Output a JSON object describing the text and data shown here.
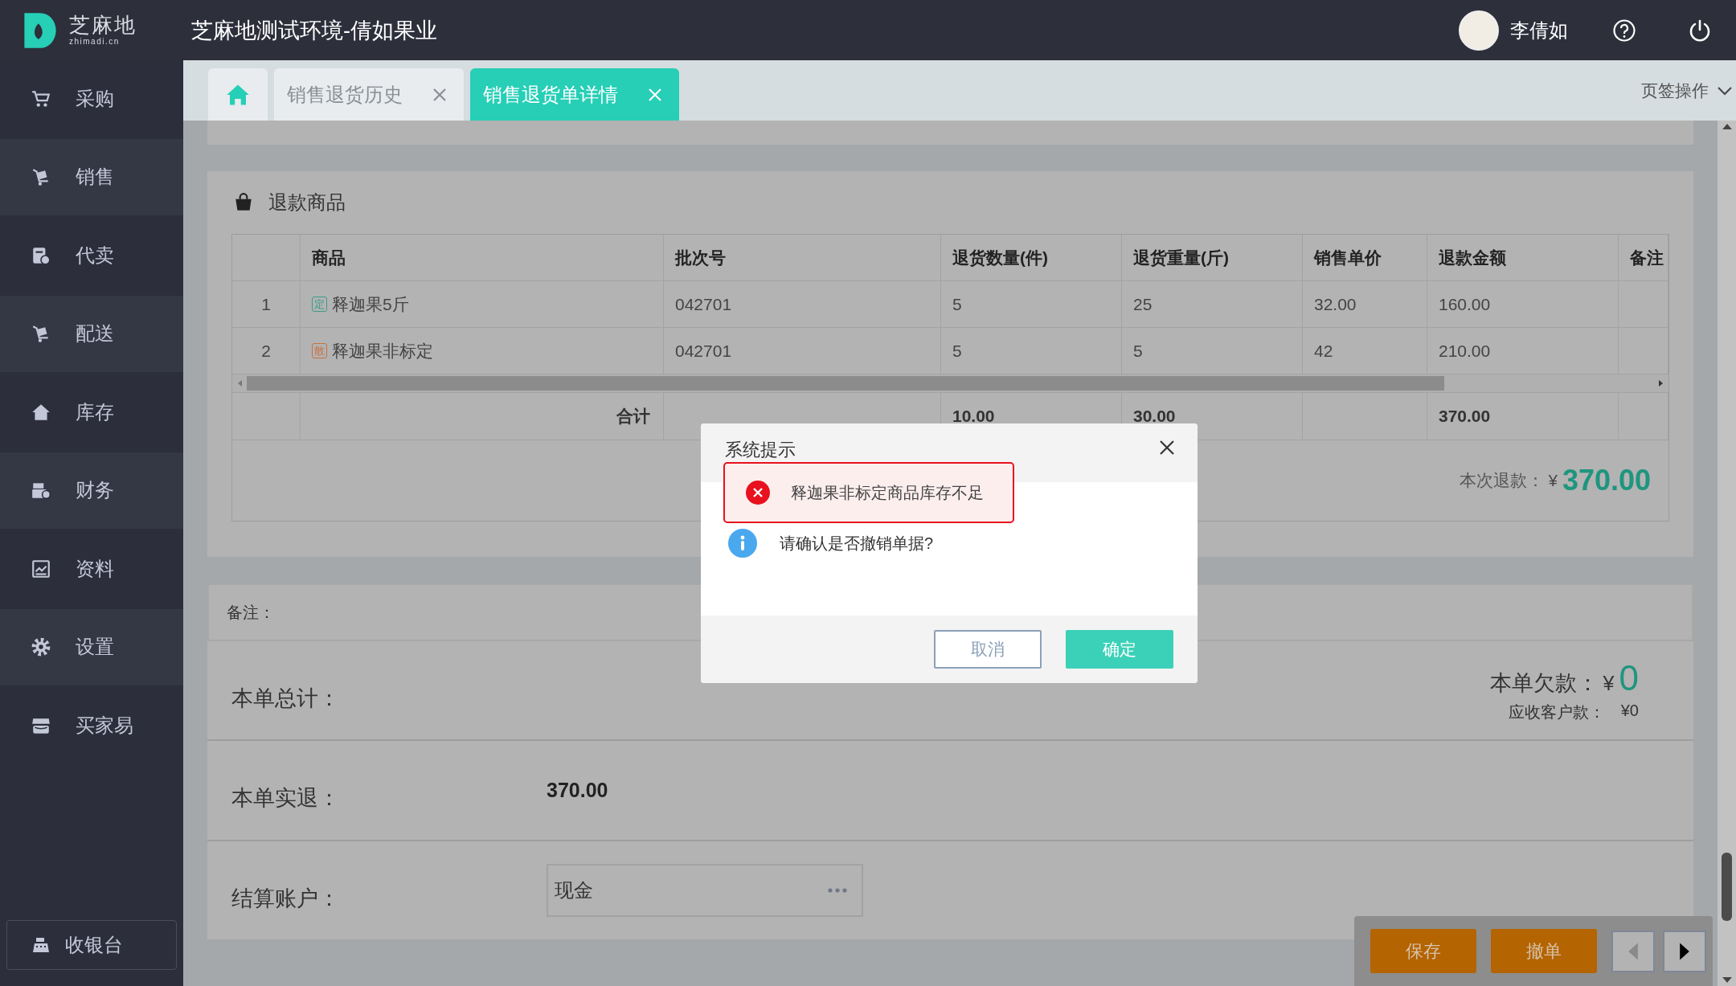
{
  "app": {
    "logo_text": "芝麻地",
    "logo_subtext": "zhimadi.cn",
    "title": "芝麻地测试环境-倩如果业"
  },
  "user": {
    "name": "李倩如"
  },
  "sidebar": {
    "items": [
      {
        "label": "采购",
        "kind": "cart"
      },
      {
        "label": "销售",
        "kind": "trolley"
      },
      {
        "label": "代卖",
        "kind": "document"
      },
      {
        "label": "配送",
        "kind": "trolley"
      },
      {
        "label": "库存",
        "kind": "house"
      },
      {
        "label": "财务",
        "kind": "register"
      },
      {
        "label": "资料",
        "kind": "board"
      },
      {
        "label": "设置",
        "kind": "gear"
      },
      {
        "label": "买家易",
        "kind": "store"
      }
    ],
    "cashier": "收银台"
  },
  "tabs": [
    {
      "kind": "home",
      "selected": false
    },
    {
      "kind": "page",
      "label": "销售退货历史",
      "selected": false
    },
    {
      "kind": "page",
      "label": "销售退货单详情",
      "selected": true
    }
  ],
  "tab_actions": "页签操作",
  "refund_goods": {
    "title": "退款商品",
    "columns": [
      "",
      "商品",
      "批次号",
      "退货数量(件)",
      "退货重量(斤)",
      "销售单价",
      "退款金额",
      "备注"
    ],
    "rows": [
      {
        "index": "1",
        "tag": {
          "text": "定",
          "color": "#3a9e85"
        },
        "name": "释迦果5斤",
        "batch": "042701",
        "qty": "5",
        "weight": "25",
        "price": "32.00",
        "amount": "160.00"
      },
      {
        "index": "2",
        "tag": {
          "text": "散",
          "color": "#c8703e"
        },
        "name": "释迦果非标定",
        "batch": "042701",
        "qty": "5",
        "weight": "5",
        "price": "42",
        "amount": "210.00"
      }
    ],
    "total": {
      "label": "合计",
      "qty": "10.00",
      "weight": "30.00",
      "amount": "370.00"
    },
    "refund_label": "本次退款：",
    "refund_currency": "¥",
    "refund_amount": "370.00"
  },
  "remark_label": "备注：",
  "summary": {
    "total_label": "本单总计：",
    "debt_label": "本单欠款：",
    "debt_currency": "¥",
    "debt_value": "0",
    "receivable_label": "应收客户款：",
    "receivable_value": "¥0",
    "actual_label": "本单实退：",
    "actual_value": "370.00",
    "account_label": "结算账户：",
    "account_value": "现金"
  },
  "actions": [
    {
      "label": "保存"
    },
    {
      "label": "撤单"
    }
  ],
  "nav": [
    {
      "kind": "prev",
      "disabled": true
    },
    {
      "kind": "next",
      "disabled": false
    }
  ],
  "dialog": {
    "title": "系统提示",
    "error": "释迦果非标定商品库存不足",
    "message": "请确认是否撤销单据?",
    "buttons": [
      {
        "label": "取消",
        "kind": "secondary"
      },
      {
        "label": "确定",
        "kind": "primary"
      }
    ]
  }
}
